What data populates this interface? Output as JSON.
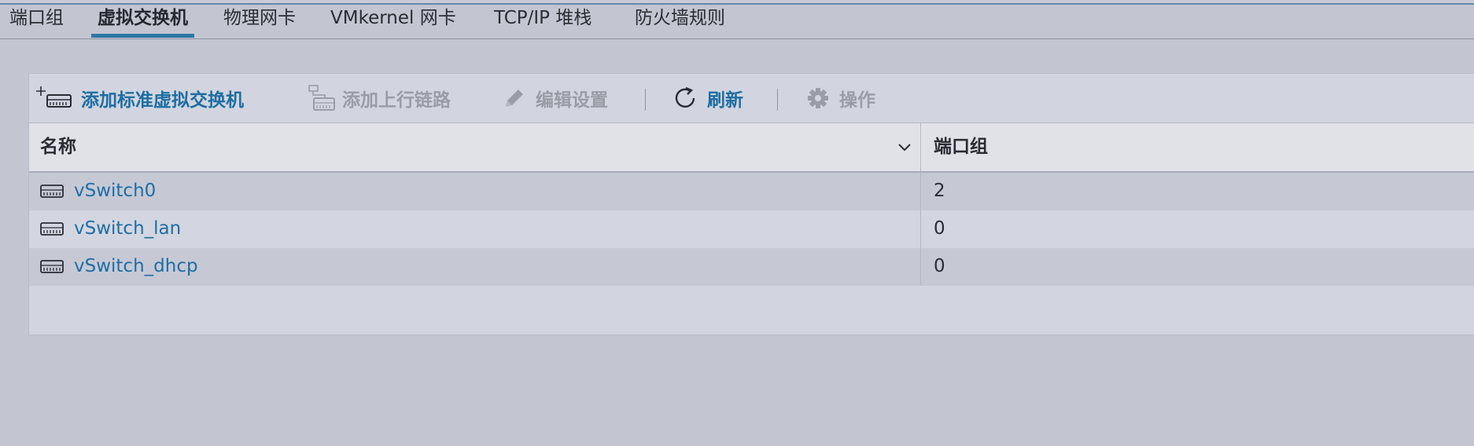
{
  "tabs": [
    {
      "label": "端口组",
      "active": false
    },
    {
      "label": "虚拟交换机",
      "active": true
    },
    {
      "label": "物理网卡",
      "active": false
    },
    {
      "label": "VMkernel 网卡",
      "active": false
    },
    {
      "label": "TCP/IP 堆栈",
      "active": false
    },
    {
      "label": "防火墙规则",
      "active": false
    }
  ],
  "toolbar": {
    "add_switch": {
      "label": "添加标准虚拟交换机",
      "icon": "add-switch-icon",
      "enabled": true
    },
    "add_uplink": {
      "label": "添加上行链路",
      "icon": "add-uplink-icon",
      "enabled": false
    },
    "edit": {
      "label": "编辑设置",
      "icon": "pencil-icon",
      "enabled": false
    },
    "refresh": {
      "label": "刷新",
      "icon": "refresh-icon",
      "enabled": true
    },
    "actions": {
      "label": "操作",
      "icon": "gear-icon",
      "enabled": false
    }
  },
  "grid": {
    "columns": [
      {
        "label": "名称",
        "sorted": "descending"
      },
      {
        "label": "端口组"
      }
    ],
    "rows": [
      {
        "name": "vSwitch0",
        "port_groups": "2"
      },
      {
        "name": "vSwitch_lan",
        "port_groups": "0"
      },
      {
        "name": "vSwitch_dhcp",
        "port_groups": "0"
      }
    ]
  },
  "colors": {
    "link": "#1f6ea5",
    "tab_underline": "#2f76a6",
    "background": "#c3c5d1",
    "disabled": "#9a9ca6"
  }
}
